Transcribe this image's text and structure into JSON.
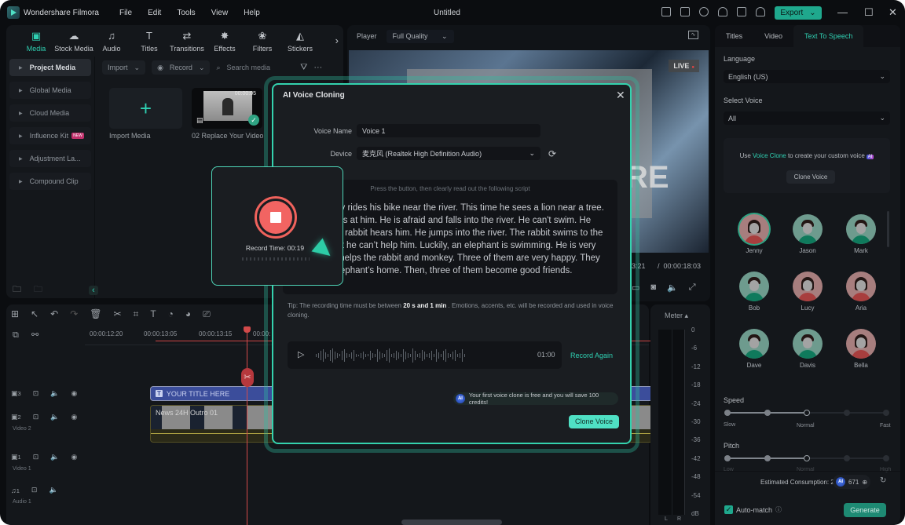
{
  "titlebar": {
    "app_name": "Wondershare Filmora",
    "menu": [
      "File",
      "Edit",
      "Tools",
      "View",
      "Help"
    ],
    "document_title": "Untitled",
    "export_label": "Export",
    "window_controls": {
      "minimize": "—",
      "maximize": "☐",
      "close": "✕"
    }
  },
  "media_panel": {
    "tabs": [
      {
        "label": "Media",
        "icon": "media-icon",
        "glyph": "▣",
        "active": true
      },
      {
        "label": "Stock Media",
        "icon": "stock-media-icon",
        "glyph": "☁",
        "active": false
      },
      {
        "label": "Audio",
        "icon": "music-icon",
        "glyph": "♫",
        "active": false
      },
      {
        "label": "Titles",
        "icon": "titles-icon",
        "glyph": "T",
        "active": false
      },
      {
        "label": "Transitions",
        "icon": "transitions-icon",
        "glyph": "⇄",
        "active": false
      },
      {
        "label": "Effects",
        "icon": "effects-icon",
        "glyph": "✸",
        "active": false
      },
      {
        "label": "Filters",
        "icon": "filters-icon",
        "glyph": "❀",
        "active": false
      },
      {
        "label": "Stickers",
        "icon": "stickers-icon",
        "glyph": "◭",
        "active": false
      }
    ],
    "next_glyph": "›",
    "sidebar": [
      {
        "label": "Project Media",
        "active": true
      },
      {
        "label": "Global Media"
      },
      {
        "label": "Cloud Media"
      },
      {
        "label": "Influence Kit",
        "badge": "NEW"
      },
      {
        "label": "Adjustment La..."
      },
      {
        "label": "Compound Clip"
      }
    ],
    "import_label": "Import",
    "record_label": "Record",
    "search_placeholder": "Search media",
    "items": [
      {
        "label": "Import Media",
        "type": "import"
      },
      {
        "label": "02 Replace Your Video",
        "duration": "00:00:05",
        "selected": true
      }
    ]
  },
  "player": {
    "label": "Player",
    "quality": "Full Quality",
    "live_badge": "LIVE",
    "current_time_partial": "3:21",
    "total_time": "00:00:18:03"
  },
  "timeline": {
    "ruler": [
      "00:00:12:20",
      "00:00:13:05",
      "00:00:13:15",
      "00:00:"
    ],
    "tracks": [
      {
        "index": "3",
        "name": "",
        "type": "video"
      },
      {
        "index": "2",
        "name": "Video 2",
        "type": "video"
      },
      {
        "index": "1",
        "name": "Video 1",
        "type": "video"
      },
      {
        "index": "1",
        "name": "Audio 1",
        "type": "audio"
      }
    ],
    "title_clip": "YOUR TITLE HERE",
    "video_clip": "News 24H Outro 01"
  },
  "meter": {
    "title": "Meter",
    "scale": [
      "0",
      "-6",
      "-12",
      "-18",
      "-24",
      "-30",
      "-36",
      "-42",
      "-48",
      "-54",
      "dB"
    ],
    "channels": [
      "L",
      "R"
    ]
  },
  "right_panel": {
    "tabs": [
      {
        "label": "Titles"
      },
      {
        "label": "Video"
      },
      {
        "label": "Text To Speech",
        "active": true
      }
    ],
    "language_label": "Language",
    "language_value": "English (US)",
    "select_voice_label": "Select Voice",
    "select_voice_value": "All",
    "clone_prompt_pre": "Use ",
    "clone_prompt_link": "Voice Clone",
    "clone_prompt_post": " to create your custom voice",
    "ai_badge": "AI",
    "clone_button": "Clone Voice",
    "voices": [
      {
        "name": "Jenny",
        "gender": "f",
        "selected": true
      },
      {
        "name": "Jason",
        "gender": "m"
      },
      {
        "name": "Mark",
        "gender": "m"
      },
      {
        "name": "Bob",
        "gender": "m"
      },
      {
        "name": "Lucy",
        "gender": "f"
      },
      {
        "name": "Aria",
        "gender": "f"
      },
      {
        "name": "Dave",
        "gender": "m"
      },
      {
        "name": "Davis",
        "gender": "m"
      },
      {
        "name": "Bella",
        "gender": "f"
      }
    ],
    "speed": {
      "label": "Speed",
      "steps": 5,
      "value_step": 3,
      "min_label": "Slow",
      "mid_label": "Normal",
      "max_label": "Fast"
    },
    "pitch": {
      "label": "Pitch",
      "steps": 5,
      "value_step": 3,
      "min_label": "Low",
      "mid_label": "Normal",
      "max_label": "High"
    },
    "estimated_consumption": "Estimated Consumption: 2",
    "credits": "671",
    "auto_match_label": "Auto-match",
    "auto_match_checked": true,
    "generate_label": "Generate"
  },
  "dialog": {
    "title": "AI Voice Cloning",
    "voice_name_label": "Voice Name",
    "voice_name_value": "Voice 1",
    "device_label": "Device",
    "device_value": "麦克风 (Realtek High Definition Audio)",
    "script_hint": "Press the button, then clearly read out the following script",
    "script_text": "The monkey rides his bike near the river. This time he sees a lion near a tree. The lion runs at him. He is afraid and falls into the river. He can't swim. He shouts. The rabbit hears him. He jumps into the river. The rabbit swims to the monkey, but he can’t help him. Luckily, an elephant is swimming. He is very strong. He helps the rabbit and monkey. Three of them are very happy. They go to the elephant’s home. Then, three of them become good friends.",
    "tip_pre": "Tip: The recording time must be between ",
    "tip_bold": "20 s and 1 min",
    "tip_post": " . Emotions, accents, etc. will be recorded and used in voice cloning.",
    "recording_duration": "01:00",
    "record_again_label": "Record Again",
    "free_note": "Your first voice clone is free and you will save 100 credits!",
    "clone_button": "Clone Voice"
  },
  "recorder": {
    "record_time": "Record Time: 00:19"
  },
  "colors": {
    "accent": "#2fd0b2",
    "record_red": "#f26462",
    "dialog_border": "#34d2ae",
    "export_bg": "#1fa88d"
  }
}
